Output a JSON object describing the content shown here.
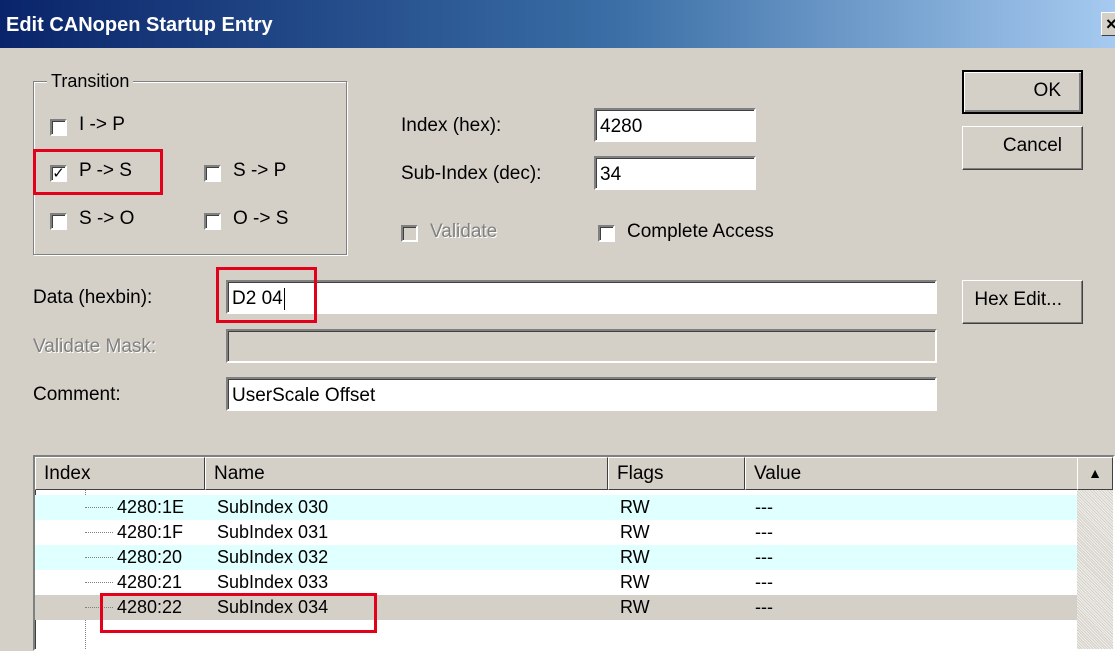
{
  "window": {
    "title": "Edit CANopen Startup Entry",
    "close_glyph": "×"
  },
  "transition": {
    "legend": "Transition",
    "options": [
      {
        "label": "I -> P",
        "checked": false
      },
      {
        "label": "P -> S",
        "checked": true
      },
      {
        "label": "S -> P",
        "checked": false
      },
      {
        "label": "S -> O",
        "checked": false
      },
      {
        "label": "O -> S",
        "checked": false
      }
    ]
  },
  "fields": {
    "index_label": "Index (hex):",
    "index_value": "4280",
    "subindex_label": "Sub-Index (dec):",
    "subindex_value": "34",
    "validate_label": "Validate",
    "complete_access_label": "Complete Access",
    "data_label": "Data (hexbin):",
    "data_value": "D2 04",
    "validate_mask_label": "Validate Mask:",
    "validate_mask_value": "",
    "comment_label": "Comment:",
    "comment_value": "UserScale Offset"
  },
  "buttons": {
    "ok": "OK",
    "cancel": "Cancel",
    "hex_edit": "Hex Edit..."
  },
  "table": {
    "columns": [
      "Index",
      "Name",
      "Flags",
      "Value"
    ],
    "rows": [
      {
        "index": "4280:1E",
        "name": "SubIndex 030",
        "flags": "RW",
        "value": "---"
      },
      {
        "index": "4280:1F",
        "name": "SubIndex 031",
        "flags": "RW",
        "value": "---"
      },
      {
        "index": "4280:20",
        "name": "SubIndex 032",
        "flags": "RW",
        "value": "---"
      },
      {
        "index": "4280:21",
        "name": "SubIndex 033",
        "flags": "RW",
        "value": "---"
      },
      {
        "index": "4280:22",
        "name": "SubIndex 034",
        "flags": "RW",
        "value": "---"
      }
    ],
    "scroll_up_glyph": "▲"
  },
  "colors": {
    "highlight": "#e3001b",
    "row_alt": "#e0ffff",
    "row_selected": "#d4d0c8",
    "title_start": "#0a246a"
  }
}
